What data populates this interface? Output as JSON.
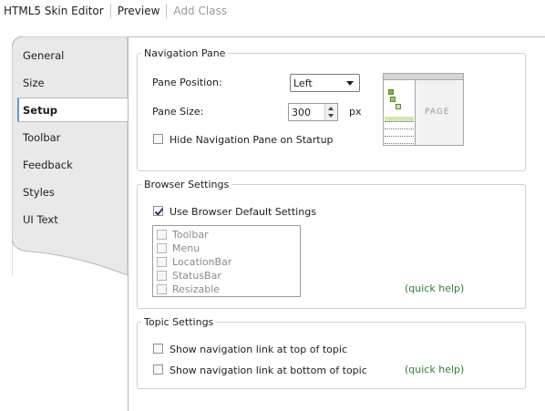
{
  "toolbar": {
    "title": "HTML5 Skin Editor",
    "preview": "Preview",
    "add_class": "Add Class"
  },
  "tabs": [
    {
      "label": "General"
    },
    {
      "label": "Size"
    },
    {
      "label": "Setup",
      "active": true
    },
    {
      "label": "Toolbar"
    },
    {
      "label": "Feedback"
    },
    {
      "label": "Styles"
    },
    {
      "label": "UI Text"
    }
  ],
  "navigation_pane": {
    "legend": "Navigation Pane",
    "position_label": "Pane Position:",
    "position_value": "Left",
    "size_label": "Pane Size:",
    "size_value": "300",
    "size_unit": "px",
    "hide_label": "Hide Navigation Pane on Startup",
    "hide_checked": false,
    "preview_text": "PAGE"
  },
  "browser_settings": {
    "legend": "Browser Settings",
    "use_default_label": "Use Browser Default Settings",
    "use_default_checked": true,
    "options": [
      {
        "label": "Toolbar",
        "checked": false
      },
      {
        "label": "Menu",
        "checked": false
      },
      {
        "label": "LocationBar",
        "checked": false
      },
      {
        "label": "StatusBar",
        "checked": false
      },
      {
        "label": "Resizable",
        "checked": false
      }
    ],
    "quick_help": "(quick help)"
  },
  "topic_settings": {
    "legend": "Topic Settings",
    "top_link_label": "Show navigation link at top of topic",
    "top_link_checked": false,
    "bottom_link_label": "Show navigation link at bottom of topic",
    "bottom_link_checked": false,
    "quick_help": "(quick help)"
  },
  "colors": {
    "accent": "#5b9bd5",
    "link": "#2e7d32",
    "tab_bg": "#e9e9e9"
  }
}
